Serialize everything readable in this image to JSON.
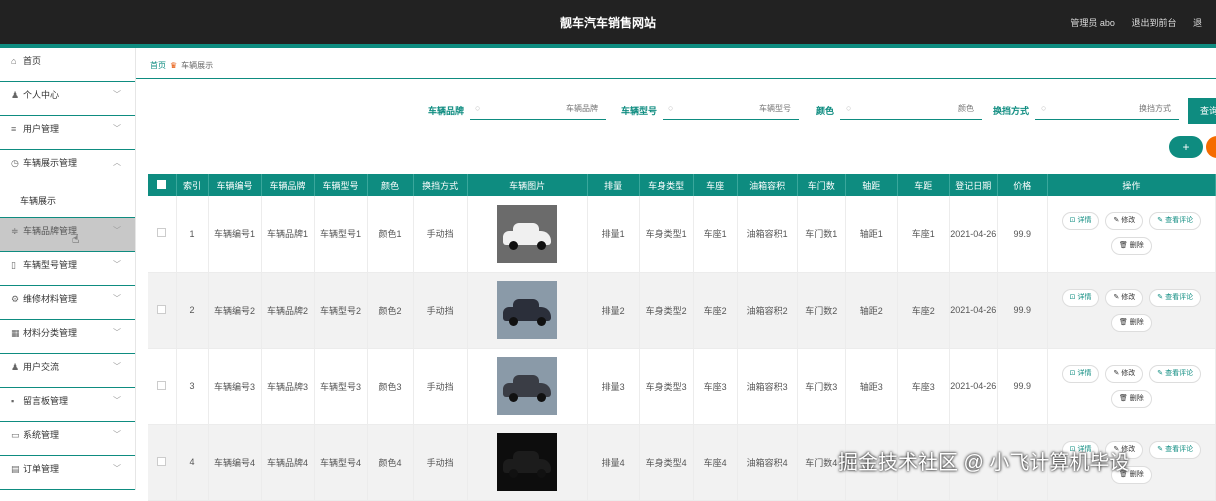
{
  "header": {
    "title": "靓车汽车销售网站",
    "admin": "管理员 abo",
    "back": "退出到前台",
    "logout": "退"
  },
  "sidebar": {
    "items": [
      {
        "icon": "home-icon",
        "glyph": "⌂",
        "label": "首页",
        "chev": ""
      },
      {
        "icon": "user-icon",
        "glyph": "♟",
        "label": "个人中心",
        "chev": "﹀"
      },
      {
        "icon": "list-icon",
        "glyph": "≡",
        "label": "用户管理",
        "chev": "﹀"
      },
      {
        "icon": "clock-icon",
        "glyph": "◷",
        "label": "车辆展示管理",
        "chev": "︿"
      },
      {
        "icon": "",
        "glyph": "",
        "label": "车辆展示",
        "chev": ""
      },
      {
        "icon": "filter-icon",
        "glyph": "≑",
        "label": "车辆品牌管理",
        "chev": "﹀"
      },
      {
        "icon": "doc-icon",
        "glyph": "▯",
        "label": "车辆型号管理",
        "chev": "﹀"
      },
      {
        "icon": "gear-icon",
        "glyph": "⚙",
        "label": "维修材料管理",
        "chev": "﹀"
      },
      {
        "icon": "grid-icon",
        "glyph": "▦",
        "label": "材料分类管理",
        "chev": "﹀"
      },
      {
        "icon": "person-icon",
        "glyph": "♟",
        "label": "用户交流",
        "chev": "﹀"
      },
      {
        "icon": "board-icon",
        "glyph": "▪",
        "label": "留言板管理",
        "chev": "﹀"
      },
      {
        "icon": "system-icon",
        "glyph": "▭",
        "label": "系统管理",
        "chev": "﹀"
      },
      {
        "icon": "order-icon",
        "glyph": "▤",
        "label": "订单管理",
        "chev": "﹀"
      }
    ]
  },
  "breadcrumb": {
    "home": "首页",
    "current": "车辆展示"
  },
  "search": {
    "fields": [
      {
        "label": "车辆品牌",
        "placeholder": "车辆品牌"
      },
      {
        "label": "车辆型号",
        "placeholder": "车辆型号"
      },
      {
        "label": "颜色",
        "placeholder": "颜色"
      },
      {
        "label": "换挡方式",
        "placeholder": "换挡方式"
      }
    ],
    "query_label": "查询"
  },
  "actions": {
    "add": "+"
  },
  "table": {
    "headers": [
      "",
      "索引",
      "车辆编号",
      "车辆品牌",
      "车辆型号",
      "颜色",
      "换挡方式",
      "车辆图片",
      "排量",
      "车身类型",
      "车座",
      "油箱容积",
      "车门数",
      "轴距",
      "车距",
      "登记日期",
      "价格",
      "操作"
    ],
    "rows": [
      [
        "1",
        "车辆编号1",
        "车辆品牌1",
        "车辆型号1",
        "颜色1",
        "手动挡",
        "",
        "排量1",
        "车身类型1",
        "车座1",
        "油箱容积1",
        "车门数1",
        "轴距1",
        "车座1",
        "2021-04-26",
        "99.9"
      ],
      [
        "2",
        "车辆编号2",
        "车辆品牌2",
        "车辆型号2",
        "颜色2",
        "手动挡",
        "",
        "排量2",
        "车身类型2",
        "车座2",
        "油箱容积2",
        "车门数2",
        "轴距2",
        "车座2",
        "2021-04-26",
        "99.9"
      ],
      [
        "3",
        "车辆编号3",
        "车辆品牌3",
        "车辆型号3",
        "颜色3",
        "手动挡",
        "",
        "排量3",
        "车身类型3",
        "车座3",
        "油箱容积3",
        "车门数3",
        "轴距3",
        "车座3",
        "2021-04-26",
        "99.9"
      ],
      [
        "4",
        "车辆编号4",
        "车辆品牌4",
        "车辆型号4",
        "颜色4",
        "手动挡",
        "",
        "排量4",
        "车身类型4",
        "车座4",
        "油箱容积4",
        "车门数4",
        "",
        "",
        "",
        ""
      ]
    ],
    "car_colors": [
      "#f0f0f0",
      "#2b2f3a",
      "#3a3d45",
      "#1c1c1c"
    ],
    "ops": {
      "detail": "⊡ 详情",
      "edit": "✎ 修改",
      "comments": "✎ 查看评论",
      "delete": "🗑 删除"
    }
  },
  "watermark": "掘金技术社区 @ 小飞计算机毕设"
}
